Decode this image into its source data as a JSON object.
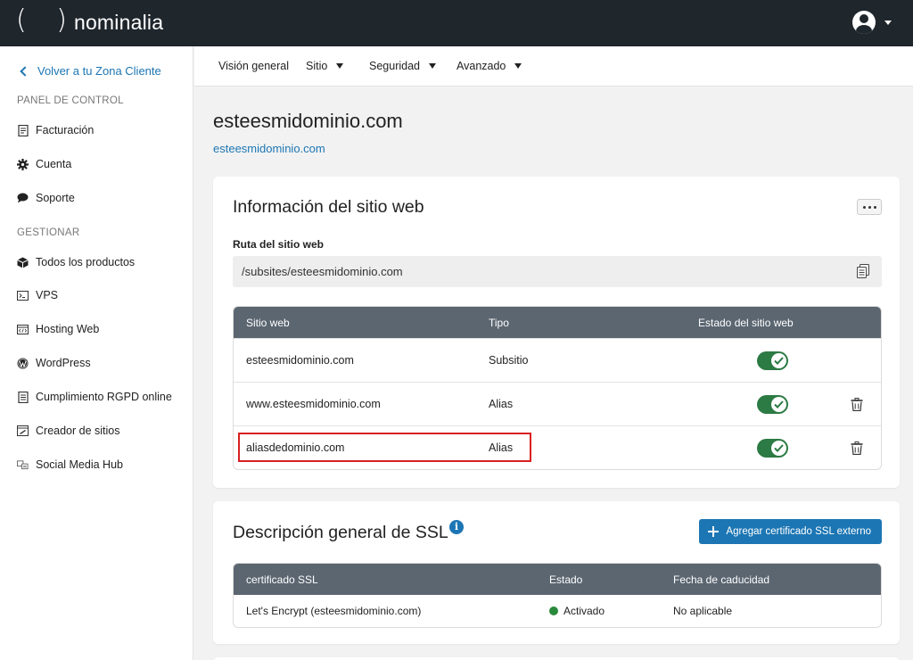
{
  "brand": {
    "name": "nominalia",
    "mark": "( )"
  },
  "colors": {
    "accent": "#1c76b4",
    "topbar": "#1f262c",
    "toggle_on": "#2c7a44",
    "status_active": "#2a8a3c",
    "highlight": "#d92020",
    "table_header": "#5b6671"
  },
  "sidebar": {
    "back_label": "Volver a tu Zona Cliente",
    "section_panel": "PANEL DE CONTROL",
    "section_manage": "GESTIONAR",
    "panel_items": [
      {
        "label": "Facturación",
        "icon": "invoice-icon"
      },
      {
        "label": "Cuenta",
        "icon": "gear-icon"
      },
      {
        "label": "Soporte",
        "icon": "chat-bubble-icon"
      }
    ],
    "manage_items": [
      {
        "label": "Todos los productos",
        "icon": "box-icon"
      },
      {
        "label": "VPS",
        "icon": "terminal-icon"
      },
      {
        "label": "Hosting Web",
        "icon": "code-window-icon"
      },
      {
        "label": "WordPress",
        "icon": "wordpress-icon"
      },
      {
        "label": "Cumplimiento RGPD online",
        "icon": "document-icon"
      },
      {
        "label": "Creador de sitios",
        "icon": "site-builder-icon"
      },
      {
        "label": "Social Media Hub",
        "icon": "social-icon"
      }
    ]
  },
  "nav": {
    "tabs": [
      {
        "label": "Visión general",
        "dropdown": false
      },
      {
        "label": "Sitio",
        "dropdown": true
      },
      {
        "label": "Seguridad",
        "dropdown": true
      },
      {
        "label": "Avanzado",
        "dropdown": true
      }
    ]
  },
  "header": {
    "title": "esteesmidominio.com",
    "subtitle": "esteesmidominio.com"
  },
  "site_info": {
    "title": "Información del sitio web",
    "path_label": "Ruta del sitio web",
    "path_value": "/subsites/esteesmidominio.com",
    "columns": [
      "Sitio web",
      "Tipo",
      "Estado del sitio web"
    ],
    "rows": [
      {
        "site": "esteesmidominio.com",
        "type": "Subsitio",
        "enabled": true,
        "deletable": false
      },
      {
        "site": "www.esteesmidominio.com",
        "type": "Alias",
        "enabled": true,
        "deletable": true
      },
      {
        "site": "aliasdedominio.com",
        "type": "Alias",
        "enabled": true,
        "deletable": true
      }
    ]
  },
  "ssl": {
    "title": "Descripción general de SSL",
    "add_button": "Agregar certificado SSL externo",
    "columns": [
      "certificado SSL",
      "Estado",
      "Fecha de caducidad"
    ],
    "rows": [
      {
        "certificate": "Let's Encrypt (esteesmidominio.com)",
        "status": "Activado",
        "expiry": "No aplicable"
      }
    ]
  }
}
